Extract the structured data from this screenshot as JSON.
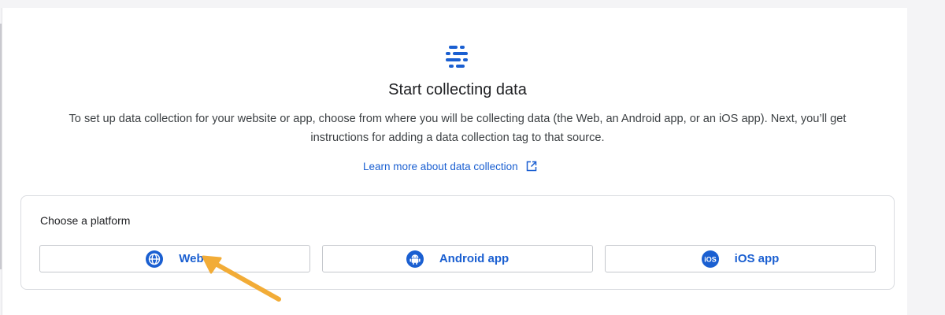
{
  "header": {
    "icon": "data-streams-icon",
    "title": "Start collecting data",
    "description": "To set up data collection for your website or app, choose from where you will be collecting data (the Web, an Android app, or an iOS app). Next, you’ll get instructions for adding a data collection tag to that source.",
    "learn_more_label": "Learn more about data collection",
    "learn_more_icon": "external-link-icon"
  },
  "platform": {
    "heading": "Choose a platform",
    "options": [
      {
        "label": "Web",
        "icon": "globe-icon"
      },
      {
        "label": "Android app",
        "icon": "android-icon"
      },
      {
        "label": "iOS app",
        "icon": "ios-icon",
        "icon_text": "iOS"
      }
    ]
  },
  "annotation": {
    "arrow_color": "#f2ac37",
    "points_to": "Web"
  },
  "colors": {
    "accent": "#1a5fd1",
    "background": "#f4f4f6",
    "panel": "#ffffff",
    "border": "#dadce0"
  }
}
